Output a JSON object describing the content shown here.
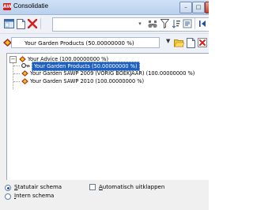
{
  "window": {
    "title": "Consolidatie",
    "app_icon_text": "AW",
    "minimize": "–",
    "maximize": "□",
    "close": "✕"
  },
  "toolbar": {
    "filter_placeholder": "",
    "entity_selected": "Your Garden Products (50.00000000 %)"
  },
  "tree": {
    "root": {
      "label": "Your Advice (100.00000000 %)",
      "expanded": true,
      "children": [
        {
          "label": "Your Garden Products (50.00000000 %)",
          "selected": true
        },
        {
          "label": "Your Garden SAWP 2009 (VORIG BOEKJAAR) (100.00000000 %)"
        },
        {
          "label": "Your Garden SAWP 2010 (100.00000000 %)"
        }
      ]
    }
  },
  "options": {
    "statutair_u": "S",
    "statutair_rest": "tatutair schema",
    "intern_u": "I",
    "intern_rest": "ntern schema",
    "auto_u": "A",
    "auto_rest": "utomatisch uitklappen",
    "statutair_checked": true,
    "auto_checked": false
  },
  "colors": {
    "accent": "#1f5fbf",
    "delete_red": "#d32020",
    "entity_icon_red": "#c0392b"
  }
}
